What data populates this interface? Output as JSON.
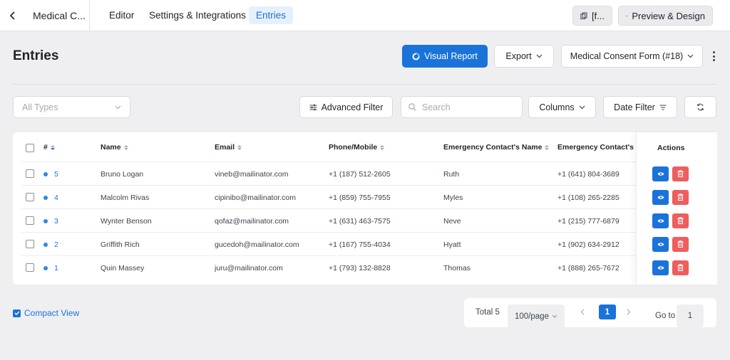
{
  "nav": {
    "form_title": "Medical C...",
    "tabs": [
      {
        "label": "Editor"
      },
      {
        "label": "Settings & Integrations"
      },
      {
        "label": "Entries"
      }
    ],
    "shortcode_label": "[f...",
    "preview_label": "Preview & Design"
  },
  "header": {
    "title": "Entries",
    "visual_report_label": "Visual Report",
    "export_label": "Export",
    "form_selector_label": "Medical Consent Form (#18)"
  },
  "filters": {
    "types_placeholder": "All Types",
    "advanced_filter_label": "Advanced Filter",
    "search_placeholder": "Search",
    "columns_label": "Columns",
    "date_filter_label": "Date Filter"
  },
  "table": {
    "columns": [
      "#",
      "Name",
      "Email",
      "Phone/Mobile",
      "Emergency Contact's Name",
      "Emergency Contact's P",
      "Actions"
    ],
    "rows": [
      {
        "id": "5",
        "name": "Bruno Logan",
        "email": "vineb@mailinator.com",
        "phone": "+1 (187) 512-2605",
        "ec_name": "Ruth",
        "ec_phone": "+1 (641) 804-3689"
      },
      {
        "id": "4",
        "name": "Malcolm Rivas",
        "email": "cipinibo@mailinator.com",
        "phone": "+1 (859) 755-7955",
        "ec_name": "Myles",
        "ec_phone": "+1 (108) 265-2285"
      },
      {
        "id": "3",
        "name": "Wynter Benson",
        "email": "qofaz@mailinator.com",
        "phone": "+1 (631) 463-7575",
        "ec_name": "Neve",
        "ec_phone": "+1 (215) 777-6879"
      },
      {
        "id": "2",
        "name": "Griffith Rich",
        "email": "gucedoh@mailinator.com",
        "phone": "+1 (167) 755-4034",
        "ec_name": "Hyatt",
        "ec_phone": "+1 (902) 634-2912"
      },
      {
        "id": "1",
        "name": "Quin Massey",
        "email": "juru@mailinator.com",
        "phone": "+1 (793) 132-8828",
        "ec_name": "Thomas",
        "ec_phone": "+1 (888) 265-7672"
      }
    ]
  },
  "footer": {
    "compact_view_label": "Compact View",
    "total_label": "Total 5",
    "page_size_label": "100/page",
    "current_page": "1",
    "goto_label": "Go to",
    "goto_value": "1"
  },
  "colors": {
    "accent": "#1a73d9",
    "danger": "#ef5d5d",
    "background": "#efeff1"
  }
}
